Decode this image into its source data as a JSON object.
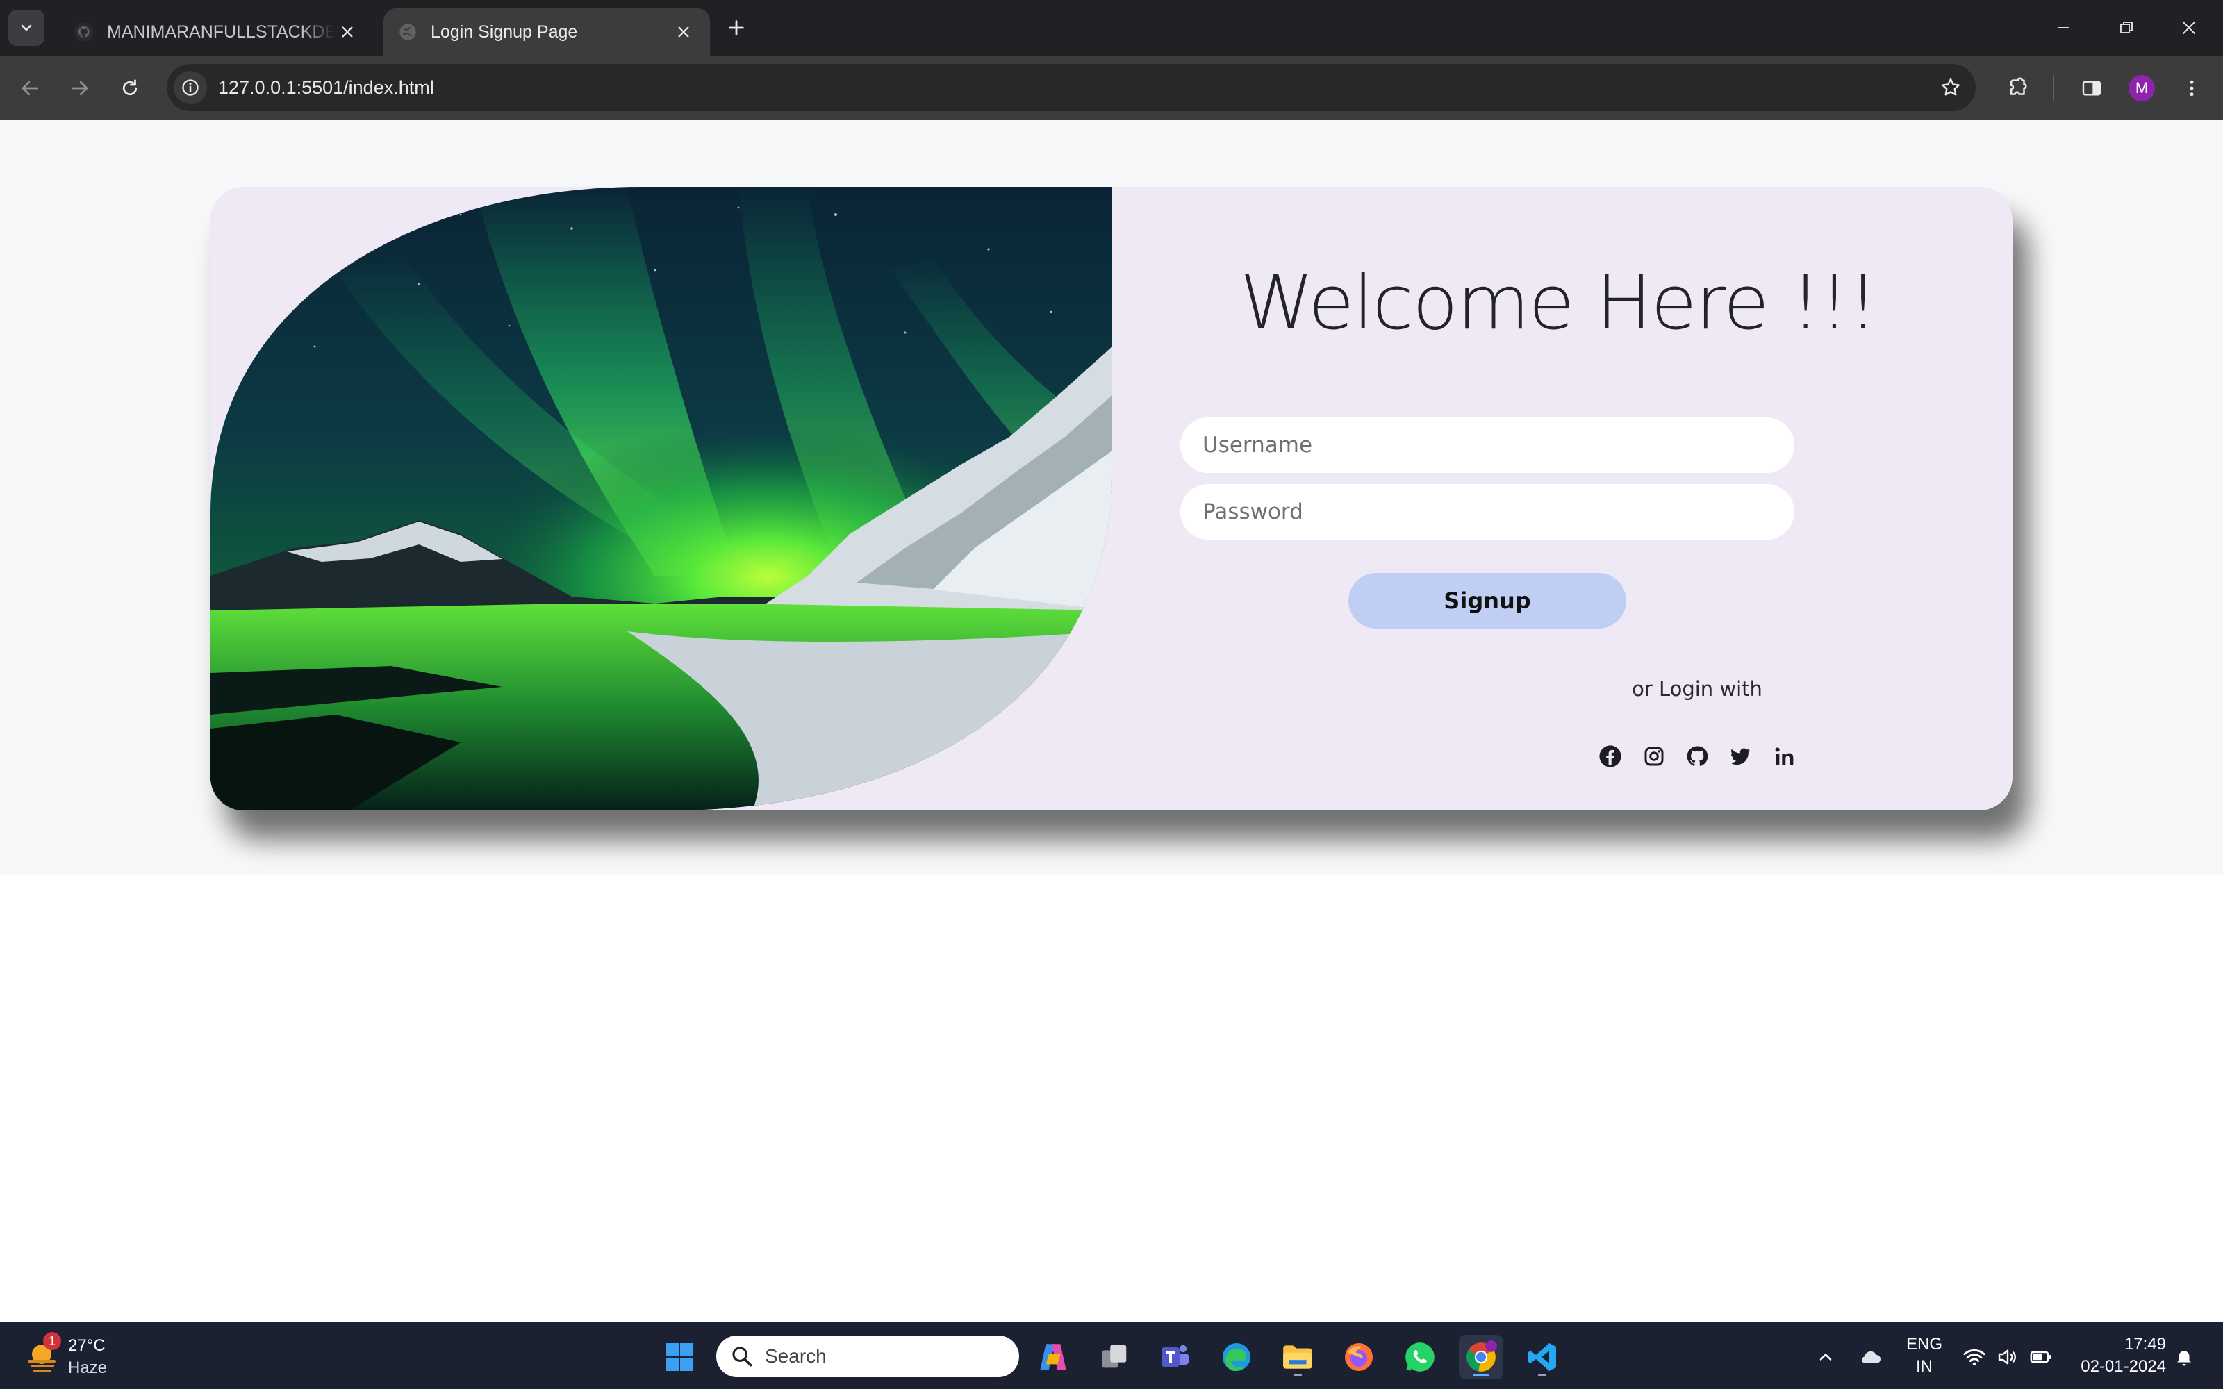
{
  "browser": {
    "tabs": [
      {
        "title": "MANIMARANFULLSTACKDEVELOPER",
        "active": false
      },
      {
        "title": "Login Signup Page",
        "active": true
      }
    ],
    "url": "127.0.0.1:5501/index.html",
    "profile_initial": "M"
  },
  "page": {
    "heading": "Welcome Here !!!",
    "username_placeholder": "Username",
    "password_placeholder": "Password",
    "signup_label": "Signup",
    "or_text": "or Login with",
    "socials": [
      "facebook-icon",
      "instagram-icon",
      "github-icon",
      "twitter-icon",
      "linkedin-icon"
    ],
    "colors": {
      "page_bg": "#f7f8fa",
      "card_bg": "#efe9f6",
      "signup_btn": "#bfcef2",
      "aurora_green": "#6bff3a"
    }
  },
  "taskbar": {
    "weather": {
      "temp": "27°C",
      "condition": "Haze",
      "badge": "1"
    },
    "search_label": "Search",
    "lang_line1": "ENG",
    "lang_line2": "IN",
    "time": "17:49",
    "date": "02-01-2024"
  }
}
